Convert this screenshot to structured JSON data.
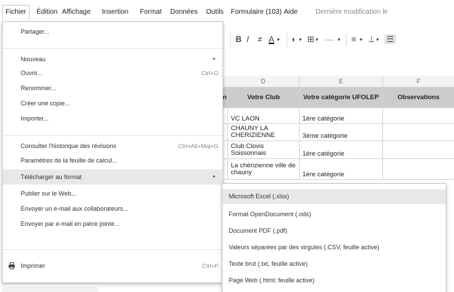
{
  "menubar": {
    "items": [
      "Fichier",
      "Édition",
      "Affichage",
      "Insertion",
      "Format",
      "Données",
      "Outils",
      "Formulaire (103)",
      "Aide"
    ],
    "last_edit": "Dernière modification le"
  },
  "toolbar": {
    "bold": "B",
    "italic": "I",
    "strike": "≠",
    "text_color": "A",
    "fill": "◖",
    "borders": "⊞",
    "merge": "—",
    "align": "≡",
    "valign": "⊥",
    "wrap": "☰"
  },
  "grid": {
    "columns": [
      "D",
      "E",
      "F"
    ],
    "headers": [
      "Votre Club",
      "Votre catégorie UFOLEP",
      "Observations"
    ],
    "rows": [
      [
        "VC LAON",
        "1ère catégorie",
        ""
      ],
      [
        "CHAUNY LA CHERIZIENNE",
        "3ème catégorie",
        ""
      ],
      [
        "Club Clovis Soissonnais",
        "1ère catégorie",
        ""
      ],
      [
        "La chérizienne ville de chauny",
        "1ère catégorie",
        ""
      ]
    ],
    "left_header_fragment": "n"
  },
  "file_menu": {
    "items": [
      {
        "label": "Partager...",
        "shortcut": ""
      },
      {
        "label": "Nouveau",
        "shortcut": "",
        "submenu": true
      },
      {
        "label": "Ouvrir...",
        "shortcut": "Ctrl+O"
      },
      {
        "label": "Renommer...",
        "shortcut": ""
      },
      {
        "label": "Créer une copie...",
        "shortcut": ""
      },
      {
        "label": "Importer...",
        "shortcut": ""
      },
      {
        "label": "Consulter l'historique des révisions",
        "shortcut": "Ctrl+Alt+Maj+G"
      },
      {
        "label": "Paramètres de la feuille de calcul...",
        "shortcut": ""
      },
      {
        "label": "Télécharger au format",
        "shortcut": "",
        "submenu": true
      },
      {
        "label": "Publier sur le Web...",
        "shortcut": ""
      },
      {
        "label": "Envoyer un e-mail aux collaborateurs...",
        "shortcut": ""
      },
      {
        "label": "Envoyer par e-mail en pièce jointe...",
        "shortcut": ""
      },
      {
        "label": "Imprimer",
        "shortcut": "Ctrl+P"
      }
    ]
  },
  "download_submenu": {
    "items": [
      "Microsoft Excel (.xlsx)",
      "Format OpenDocument (.ods)",
      "Document PDF (.pdf)",
      "Valeurs séparées par des virgules (.CSV, feuille active)",
      "Texte brut (.txt, feuille active)",
      "Page Web (.html; feuille active)"
    ]
  },
  "icons": {
    "printer": "printer-icon",
    "submenu_arrow": "▸"
  },
  "colors": {
    "header_fill": "#cccccc",
    "menu_highlight": "#e8e8e8"
  }
}
